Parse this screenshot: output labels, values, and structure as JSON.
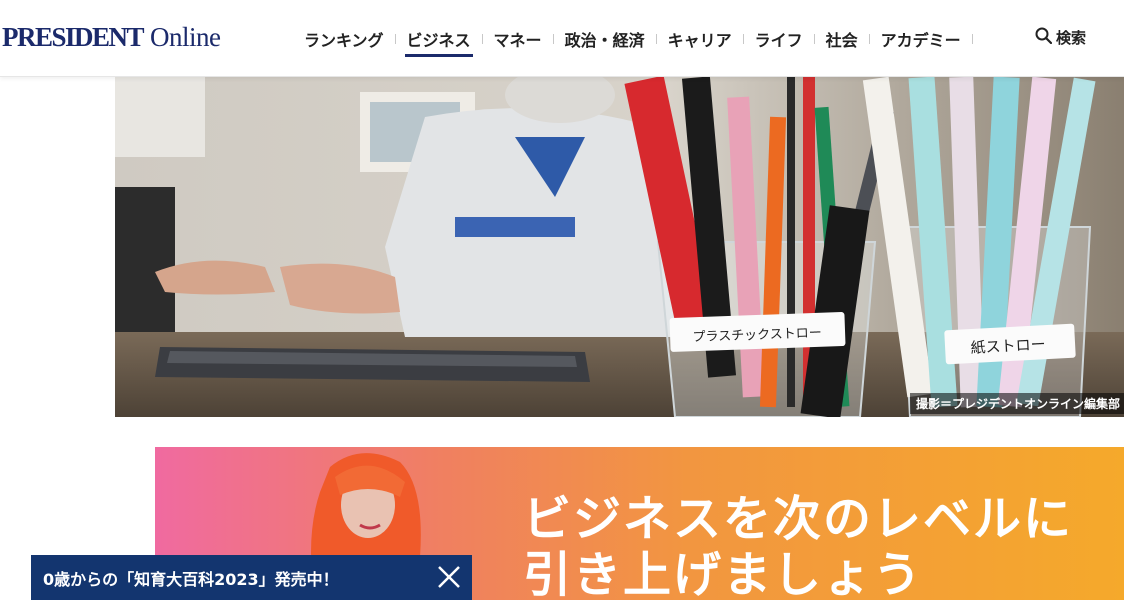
{
  "header": {
    "logo_main": "PRESIDENT",
    "logo_sub": "Online",
    "nav": [
      {
        "label": "ランキング"
      },
      {
        "label": "ビジネス",
        "active": true
      },
      {
        "label": "マネー"
      },
      {
        "label": "政治・経済"
      },
      {
        "label": "キャリア"
      },
      {
        "label": "ライフ"
      },
      {
        "label": "社会"
      },
      {
        "label": "アカデミー"
      }
    ],
    "search_label": "検索",
    "brand_color": "#1b2a6b"
  },
  "hero": {
    "label_plastic": "プラスチックストロー",
    "label_paper": "紙ストロー",
    "caption": "撮影＝プレジデントオンライン編集部"
  },
  "ad": {
    "line1": "ビジネスを次のレベルに",
    "line2": "引き上げましょう"
  },
  "banner": {
    "text": "0歳からの「知育大百科2023」発売中！",
    "color": "#13356f"
  },
  "icons": [
    "search-icon",
    "close-icon"
  ]
}
